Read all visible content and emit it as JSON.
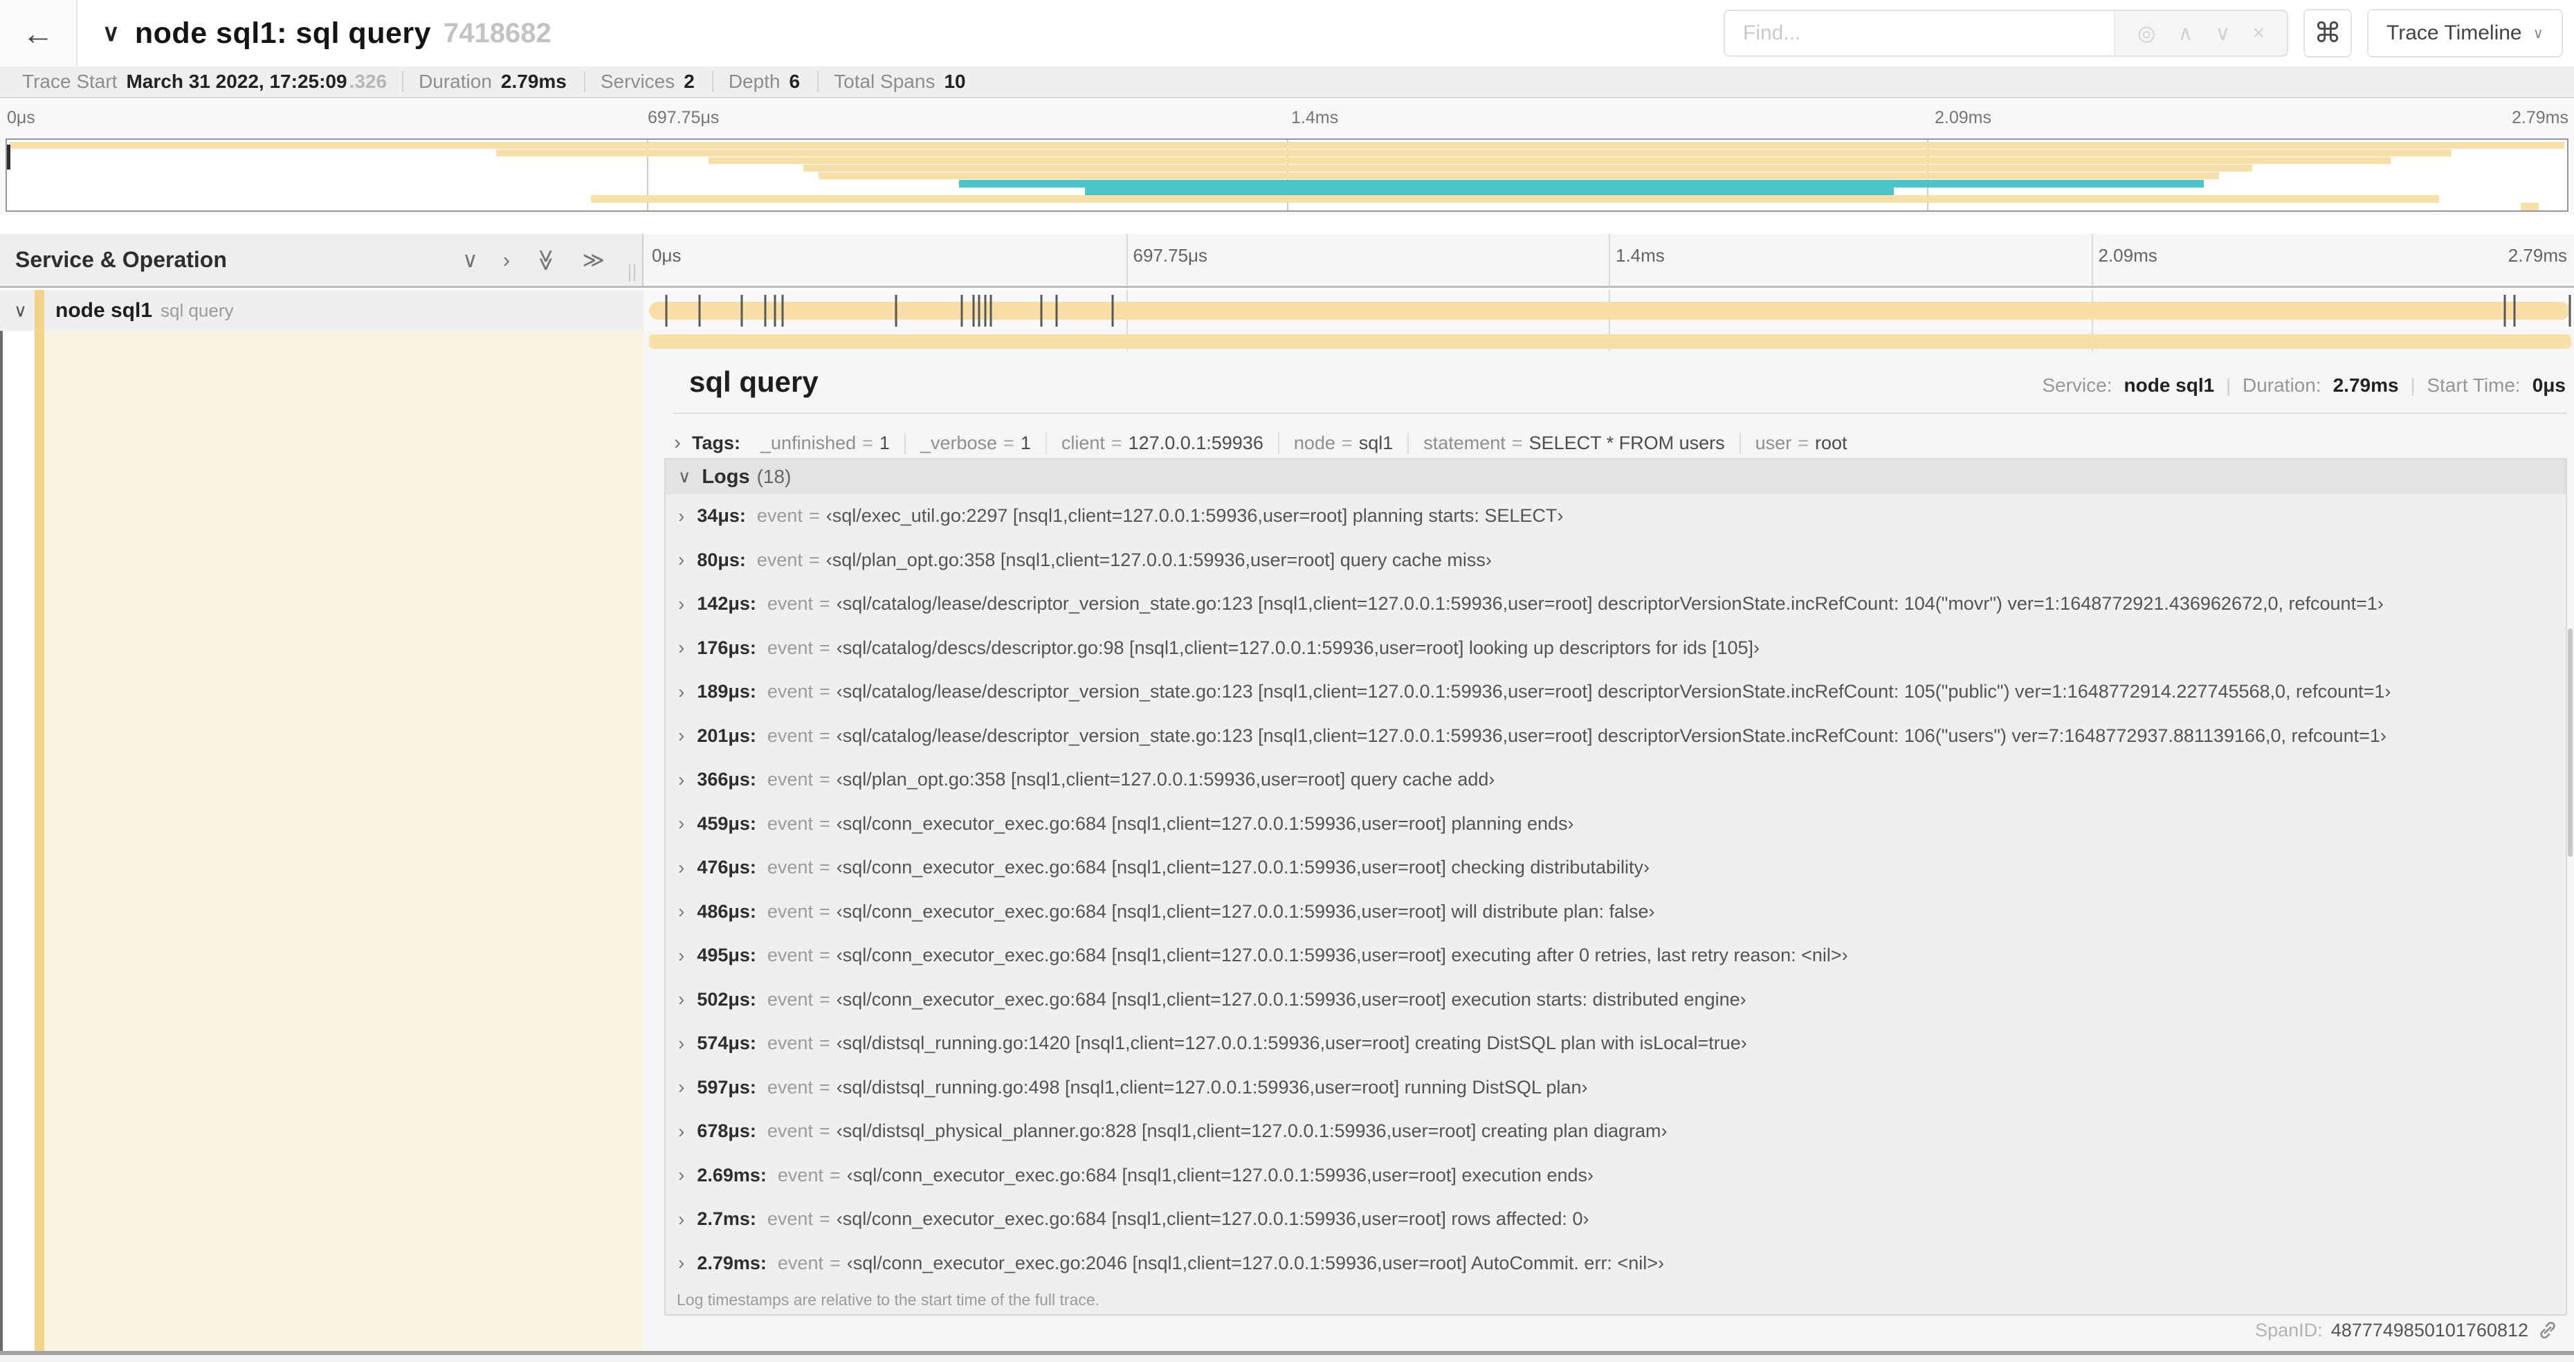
{
  "colors": {
    "tan": "#f8dfa8",
    "teal": "#49c4c8",
    "accent": "#f3d289",
    "cream": "#fbf3e1"
  },
  "icons": {
    "back": "←",
    "chevron_down": "∨",
    "chevron_up": "∧",
    "chevron_right": "›",
    "double_chevron": "≫",
    "target": "◎",
    "close": "×",
    "command": "⌘"
  },
  "header": {
    "title": "node sql1: sql query",
    "trace_id": "7418682",
    "find_placeholder": "Find...",
    "view_selector": "Trace Timeline"
  },
  "summary": {
    "items": [
      {
        "label": "Trace Start",
        "value": "March 31 2022, 17:25:09",
        "suffix": ".326"
      },
      {
        "label": "Duration",
        "value": "2.79ms"
      },
      {
        "label": "Services",
        "value": "2"
      },
      {
        "label": "Depth",
        "value": "6"
      },
      {
        "label": "Total Spans",
        "value": "10"
      }
    ]
  },
  "axis": {
    "ticks": [
      "0μs",
      "697.75μs",
      "1.4ms",
      "2.09ms",
      "2.79ms"
    ]
  },
  "minimap": {
    "bars": [
      {
        "start": 0.1,
        "end": 99.9,
        "color": "tan"
      },
      {
        "start": 19.1,
        "end": 95.5,
        "color": "tan"
      },
      {
        "start": 27.4,
        "end": 93.1,
        "color": "tan"
      },
      {
        "start": 31.1,
        "end": 87.7,
        "color": "tan"
      },
      {
        "start": 31.7,
        "end": 86.4,
        "color": "tan"
      },
      {
        "start": 37.2,
        "end": 85.8,
        "color": "teal"
      },
      {
        "start": 42.1,
        "end": 73.7,
        "color": "teal"
      },
      {
        "start": 22.8,
        "end": 95.0,
        "color": "tan"
      },
      {
        "start": 98.2,
        "end": 98.9,
        "color": "tan"
      }
    ]
  },
  "spanlist": {
    "column_header": "Service & Operation",
    "service": "node sql1",
    "operation": "sql query",
    "log_markers_pct": [
      1.2,
      2.9,
      5.1,
      6.3,
      6.8,
      7.2,
      13.1,
      16.5,
      17.1,
      17.4,
      17.7,
      18.0,
      20.6,
      21.4,
      24.3,
      96.4,
      96.9,
      99.8
    ]
  },
  "detail": {
    "title": "sql query",
    "service_label": "Service:",
    "service": "node sql1",
    "duration_label": "Duration:",
    "duration": "2.79ms",
    "start_label": "Start Time:",
    "start": "0μs",
    "tags_label": "Tags:",
    "tags": [
      {
        "key": "_unfinished",
        "value": "1"
      },
      {
        "key": "_verbose",
        "value": "1"
      },
      {
        "key": "client",
        "value": "127.0.0.1:59936"
      },
      {
        "key": "node",
        "value": "sql1"
      },
      {
        "key": "statement",
        "value": "SELECT * FROM users"
      },
      {
        "key": "user",
        "value": "root"
      }
    ],
    "logs_label": "Logs",
    "logs_count": "(18)",
    "log_field_key": "event",
    "logs": [
      {
        "time": "34μs:",
        "value": "‹sql/exec_util.go:2297 [nsql1,client=127.0.0.1:59936,user=root] planning starts: SELECT›"
      },
      {
        "time": "80μs:",
        "value": "‹sql/plan_opt.go:358 [nsql1,client=127.0.0.1:59936,user=root] query cache miss›"
      },
      {
        "time": "142μs:",
        "value": "‹sql/catalog/lease/descriptor_version_state.go:123 [nsql1,client=127.0.0.1:59936,user=root] descriptorVersionState.incRefCount: 104(\"movr\") ver=1:1648772921.436962672,0, refcount=1›"
      },
      {
        "time": "176μs:",
        "value": "‹sql/catalog/descs/descriptor.go:98 [nsql1,client=127.0.0.1:59936,user=root] looking up descriptors for ids [105]›"
      },
      {
        "time": "189μs:",
        "value": "‹sql/catalog/lease/descriptor_version_state.go:123 [nsql1,client=127.0.0.1:59936,user=root] descriptorVersionState.incRefCount: 105(\"public\") ver=1:1648772914.227745568,0, refcount=1›"
      },
      {
        "time": "201μs:",
        "value": "‹sql/catalog/lease/descriptor_version_state.go:123 [nsql1,client=127.0.0.1:59936,user=root] descriptorVersionState.incRefCount: 106(\"users\") ver=7:1648772937.881139166,0, refcount=1›"
      },
      {
        "time": "366μs:",
        "value": "‹sql/plan_opt.go:358 [nsql1,client=127.0.0.1:59936,user=root] query cache add›"
      },
      {
        "time": "459μs:",
        "value": "‹sql/conn_executor_exec.go:684 [nsql1,client=127.0.0.1:59936,user=root] planning ends›"
      },
      {
        "time": "476μs:",
        "value": "‹sql/conn_executor_exec.go:684 [nsql1,client=127.0.0.1:59936,user=root] checking distributability›"
      },
      {
        "time": "486μs:",
        "value": "‹sql/conn_executor_exec.go:684 [nsql1,client=127.0.0.1:59936,user=root] will distribute plan: false›"
      },
      {
        "time": "495μs:",
        "value": "‹sql/conn_executor_exec.go:684 [nsql1,client=127.0.0.1:59936,user=root] executing after 0 retries, last retry reason: <nil>›"
      },
      {
        "time": "502μs:",
        "value": "‹sql/conn_executor_exec.go:684 [nsql1,client=127.0.0.1:59936,user=root] execution starts: distributed engine›"
      },
      {
        "time": "574μs:",
        "value": "‹sql/distsql_running.go:1420 [nsql1,client=127.0.0.1:59936,user=root] creating DistSQL plan with isLocal=true›"
      },
      {
        "time": "597μs:",
        "value": "‹sql/distsql_running.go:498 [nsql1,client=127.0.0.1:59936,user=root] running DistSQL plan›"
      },
      {
        "time": "678μs:",
        "value": "‹sql/distsql_physical_planner.go:828 [nsql1,client=127.0.0.1:59936,user=root] creating plan diagram›"
      },
      {
        "time": "2.69ms:",
        "value": "‹sql/conn_executor_exec.go:684 [nsql1,client=127.0.0.1:59936,user=root] execution ends›"
      },
      {
        "time": "2.7ms:",
        "value": "‹sql/conn_executor_exec.go:684 [nsql1,client=127.0.0.1:59936,user=root] rows affected: 0›"
      },
      {
        "time": "2.79ms:",
        "value": "‹sql/conn_executor_exec.go:2046 [nsql1,client=127.0.0.1:59936,user=root] AutoCommit. err: <nil>›"
      }
    ],
    "logs_note": "Log timestamps are relative to the start time of the full trace.",
    "spanid_label": "SpanID:",
    "spanid": "4877749850101760812"
  }
}
